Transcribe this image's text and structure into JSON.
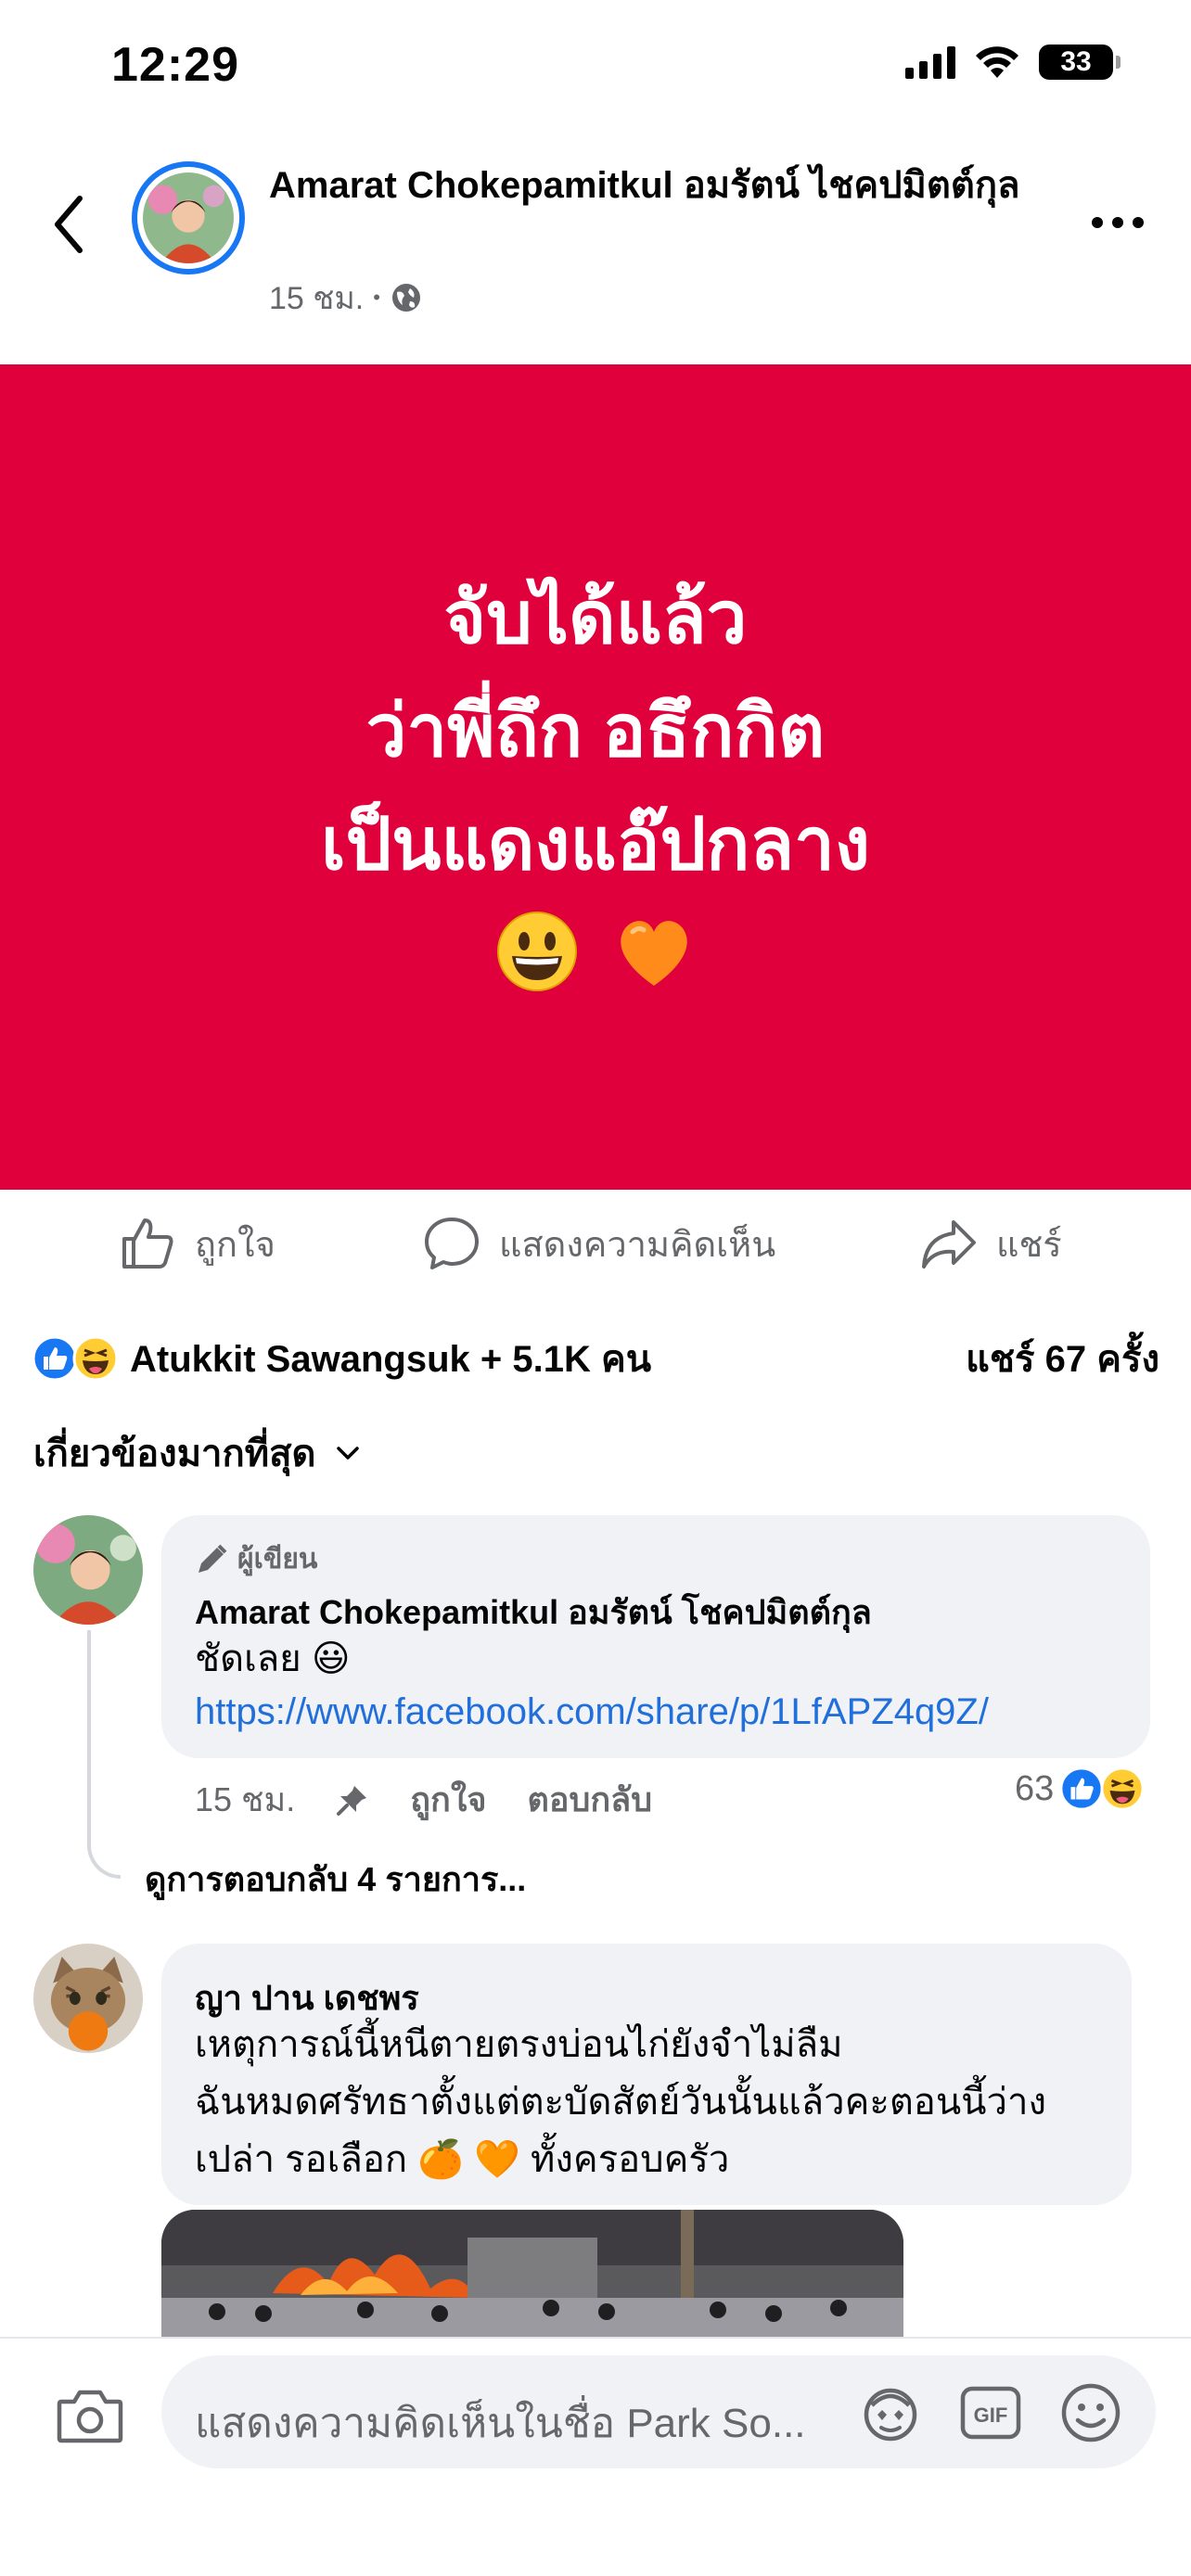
{
  "status_bar": {
    "time": "12:29",
    "battery": "33"
  },
  "header": {
    "author": "Amarat Chokepamitkul อมรัตน์ ไชคปมิตต์กุล",
    "time": "15 ชม.",
    "separator": "•"
  },
  "post": {
    "lines": [
      "จับได้แล้ว",
      "ว่าพี่ถึก อธึกกิต",
      "เป็นแดงแอ๊ปกลาง"
    ],
    "emoji_1": "😃",
    "emoji_2": "🧡"
  },
  "actions": {
    "like": "ถูกใจ",
    "comment": "แสดงความคิดเห็น",
    "share": "แชร์"
  },
  "reactions": {
    "text": "Atukkit Sawangsuk + 5.1K คน",
    "shares": "แชร์ 67 ครั้ง"
  },
  "sort": {
    "label": "เกี่ยวข้องมากที่สุด"
  },
  "comments": [
    {
      "badge": "ผู้เขียน",
      "name": "Amarat Chokepamitkul อมรัตน์ โชคปมิตต์กุล",
      "text": "ชัดเลย 😃",
      "link": "https://www.facebook.com/share/p/1LfAPZ4q9Z/",
      "time": "15 ชม.",
      "like": "ถูกใจ",
      "reply": "ตอบกลับ",
      "reaction_count": "63",
      "view_replies": "ดูการตอบกลับ 4 รายการ..."
    },
    {
      "name": "ญา ปาน เดชพร",
      "lines": [
        "เหตุการณ์นี้หนีตายตรงบ่อนไก่ยังจำไม่ลืม",
        "ฉันหมดศรัทธาตั้งแต่ตะบัดสัตย์วันนั้นแล้วคะตอนนี้ว่าง",
        "เปล่า รอเลือก 🍊 🧡 ทั้งครอบครัว"
      ]
    }
  ],
  "composer": {
    "placeholder": "แสดงความคิดเห็นในชื่อ Park So..."
  },
  "colors": {
    "card_red": "#e0003c",
    "link_blue": "#216fdb",
    "accent_blue": "#1877f2"
  }
}
